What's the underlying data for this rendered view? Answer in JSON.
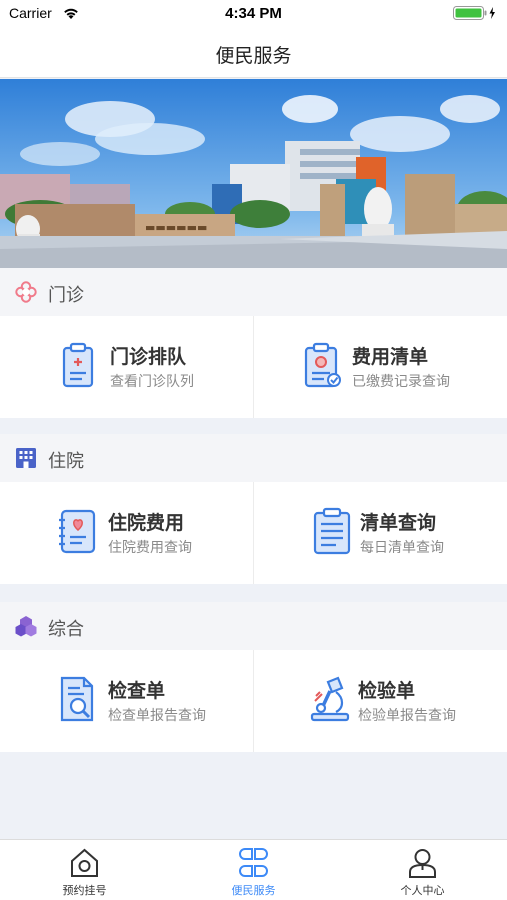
{
  "status_bar": {
    "carrier": "Carrier",
    "time": "4:34 PM"
  },
  "nav": {
    "title": "便民服务"
  },
  "sections": [
    {
      "label": "门诊",
      "icon": "flower-icon",
      "color": "#f07a8a",
      "items": [
        {
          "title": "门诊排队",
          "subtitle": "查看门诊队列",
          "icon": "queue-clipboard-icon"
        },
        {
          "title": "费用清单",
          "subtitle": "已缴费记录查询",
          "icon": "fee-badge-icon"
        }
      ]
    },
    {
      "label": "住院",
      "icon": "building-icon",
      "color": "#4a63c8",
      "items": [
        {
          "title": "住院费用",
          "subtitle": "住院费用查询",
          "icon": "heart-notebook-icon"
        },
        {
          "title": "清单查询",
          "subtitle": "每日清单查询",
          "icon": "list-clipboard-icon"
        }
      ]
    },
    {
      "label": "综合",
      "icon": "cubes-icon",
      "color": "#8a63d2",
      "items": [
        {
          "title": "检查单",
          "subtitle": "检查单报告查询",
          "icon": "magnifier-document-icon"
        },
        {
          "title": "检验单",
          "subtitle": "检验单报告查询",
          "icon": "microscope-icon"
        }
      ]
    }
  ],
  "tabbar": {
    "items": [
      {
        "label": "预约挂号",
        "icon": "home-icon",
        "active": false
      },
      {
        "label": "便民服务",
        "icon": "grid-clover-icon",
        "active": true
      },
      {
        "label": "个人中心",
        "icon": "person-icon",
        "active": false
      }
    ],
    "active_color": "#3d8af7"
  }
}
